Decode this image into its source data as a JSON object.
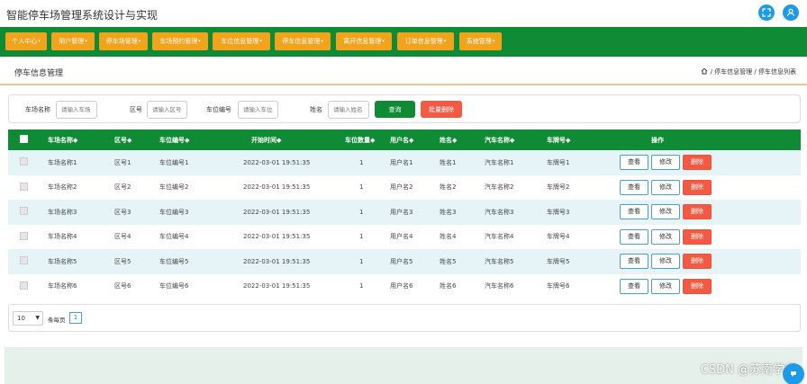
{
  "app": {
    "title": "智能停车场管理系统设计与实现"
  },
  "top_icons": [
    "expand-icon",
    "user-icon"
  ],
  "nav": {
    "items": [
      {
        "label": "个人中心"
      },
      {
        "label": "用户管理"
      },
      {
        "label": "停车场管理"
      },
      {
        "label": "车场预约管理"
      },
      {
        "label": "车位信息管理"
      },
      {
        "label": "停车信息管理"
      },
      {
        "label": "离开信息管理"
      },
      {
        "label": "订单信息管理"
      },
      {
        "label": "系统管理"
      }
    ],
    "dropdown_glyph": "▾"
  },
  "page": {
    "title": "停车信息管理",
    "breadcrumb": "/ 停车信息管理 / 停车信息列表"
  },
  "search": {
    "fields": [
      {
        "label": "车场名称",
        "placeholder": "请输入车场"
      },
      {
        "label": "区号",
        "placeholder": "请输入区号"
      },
      {
        "label": "车位编号",
        "placeholder": "请输入车位"
      },
      {
        "label": "姓名",
        "placeholder": "请输入姓名"
      }
    ],
    "query_label": "查询",
    "batch_delete_label": "批量删除"
  },
  "table": {
    "headers": [
      "",
      "车场名称◆",
      "区号◆",
      "车位编号◆",
      "开始时间◆",
      "车位数量◆",
      "用户名◆",
      "姓名◆",
      "汽车名称◆",
      "车牌号◆",
      "操作"
    ],
    "rows": [
      [
        "车场名称1",
        "区号1",
        "车位编号1",
        "2022-03-01 19:51:35",
        "1",
        "用户名1",
        "姓名1",
        "汽车名称1",
        "车牌号1"
      ],
      [
        "车场名称2",
        "区号2",
        "车位编号2",
        "2022-03-01 19:51:35",
        "1",
        "用户名2",
        "姓名2",
        "汽车名称2",
        "车牌号2"
      ],
      [
        "车场名称3",
        "区号3",
        "车位编号3",
        "2022-03-01 19:51:35",
        "1",
        "用户名3",
        "姓名3",
        "汽车名称3",
        "车牌号3"
      ],
      [
        "车场名称4",
        "区号4",
        "车位编号4",
        "2022-03-01 19:51:35",
        "1",
        "用户名4",
        "姓名4",
        "汽车名称4",
        "车牌号4"
      ],
      [
        "车场名称5",
        "区号5",
        "车位编号5",
        "2022-03-01 19:51:35",
        "1",
        "用户名5",
        "姓名5",
        "汽车名称5",
        "车牌号5"
      ],
      [
        "车场名称6",
        "区号6",
        "车位编号6",
        "2022-03-01 19:51:35",
        "1",
        "用户名6",
        "姓名6",
        "汽车名称6",
        "车牌号6"
      ]
    ],
    "actions": {
      "view_label": "查看",
      "edit_label": "修改",
      "delete_label": "删除"
    }
  },
  "pager": {
    "page_size": "10",
    "page_size_label": "条每页",
    "current_page": "1"
  },
  "watermark": "CSDN @苏南学君",
  "colors": {
    "nav_bg": "#0f8a35",
    "nav_item": "#f2a31c",
    "delete": "#f25a44",
    "accent": "#1e9be8"
  }
}
